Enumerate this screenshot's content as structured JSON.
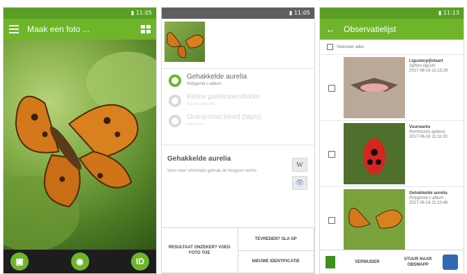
{
  "screen1": {
    "status_time": "▮ 11:05",
    "title": "Maak een foto ...",
    "bottom": {
      "gallery_icon": "gallery-icon",
      "camera_icon": "camera-icon",
      "id_label": "ID"
    }
  },
  "screen2": {
    "status_time": "▮ 11:05",
    "options": [
      {
        "name": "Gehakkelde aurelia",
        "latin": "Polygonia c-album",
        "selected": true
      },
      {
        "name": "Kleine parelmoervlinder",
        "latin": "Issoria lathonia",
        "selected": false
      },
      {
        "name": "Oranjerood kleed (tapis)",
        "latin": "Vanessa ...",
        "selected": false
      }
    ],
    "info_title": "Gehakkelde aurelia",
    "info_text": "Voor meer informatie gebruik de knoppen rechts",
    "wiki_label": "W",
    "buttons": {
      "uncertain": "RESULTAAT ONZEKER? VOEG FOTO TOE",
      "save": "TEVREDEN? SLA OP",
      "new_id": "NIEUWE IDENTIFICATIE"
    }
  },
  "screen3": {
    "status_time": "▮ 11:13",
    "title": "Observatielijst",
    "select_all": "Selecteer alles",
    "items": [
      {
        "name": "Ligusterpijlstaart",
        "latin": "Sphinx ligustri",
        "time": "2017-06-16 11:13:29"
      },
      {
        "name": "Vuurwants",
        "latin": "Pyrrhocoris apterus",
        "time": "2017-06-16 11:11:33"
      },
      {
        "name": "Gehakkelde aurelia",
        "latin": "Polygonia c-album",
        "time": "2017-06-16 11:10:48"
      }
    ],
    "delete_label": "VERWIJDER",
    "send_label": "STUUR NAAR OBSMAPP"
  }
}
